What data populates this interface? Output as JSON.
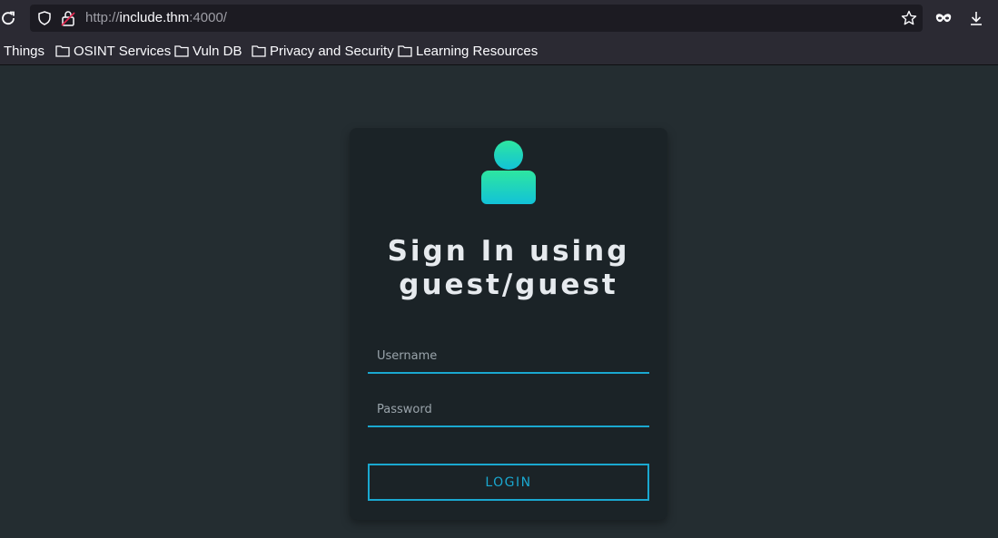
{
  "browser": {
    "url_scheme": "http://",
    "url_host": "include.thm",
    "url_port": ":4000/"
  },
  "bookmarks": [
    {
      "label": "Things"
    },
    {
      "label": "OSINT Services"
    },
    {
      "label": "Vuln DB"
    },
    {
      "label": "Privacy and Security"
    },
    {
      "label": "Learning Resources"
    }
  ],
  "login": {
    "title_line1": "Sign In using",
    "title_line2": "guest/guest",
    "username_placeholder": "Username",
    "password_placeholder": "Password",
    "button_label": "LOGIN"
  },
  "colors": {
    "accent": "#1aa8d0",
    "page_bg": "#242d31",
    "card_bg": "#1b2327",
    "avatar_top": "#2ee6a0",
    "avatar_bottom": "#12c2d8"
  },
  "icons": [
    "reload-icon",
    "shield-icon",
    "insecure-lock-icon",
    "bookmark-star-icon",
    "private-mask-icon",
    "download-icon",
    "folder-icon",
    "user-icon"
  ]
}
